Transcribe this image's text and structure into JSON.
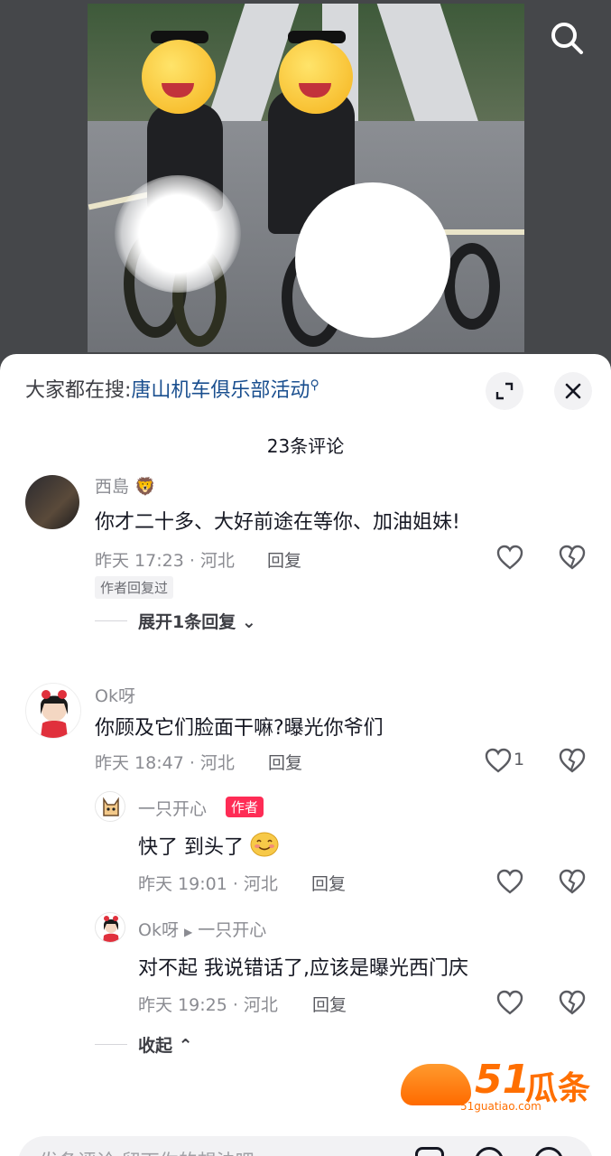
{
  "search": {
    "prefix": "大家都在搜:",
    "term": "唐山机车俱乐部活动"
  },
  "comments_header": {
    "count_label": "23条评论"
  },
  "comments": [
    {
      "username": "西島",
      "text": "你才二十多、大好前途在等你、加油姐妹!",
      "meta": "昨天 17:23 · 河北",
      "reply_label": "回复",
      "badge": "作者回复过",
      "expand_label": "展开1条回复"
    },
    {
      "username": "Ok呀",
      "text": "你顾及它们脸面干嘛?曝光你爷们",
      "meta": "昨天 18:47 · 河北",
      "reply_label": "回复",
      "like_count": "1",
      "replies": [
        {
          "username": "一只开心",
          "author_tag": "作者",
          "text": "快了 到头了",
          "meta": "昨天 19:01 · 河北",
          "reply_label": "回复"
        },
        {
          "username": "Ok呀",
          "reply_to": "一只开心",
          "text": "对不起 我说错话了,应该是曝光西门庆",
          "meta": "昨天 19:25 · 河北",
          "reply_label": "回复"
        }
      ],
      "collapse_label": "收起"
    }
  ],
  "watermark": {
    "number": "51",
    "name": "瓜条",
    "url": "51guatiao.com"
  },
  "input": {
    "placeholder": "发条评论,留下你的想法吧"
  },
  "colors": {
    "link": "#1a4f8f",
    "author_badge": "#fe2c55",
    "watermark": "#ff6f00"
  }
}
